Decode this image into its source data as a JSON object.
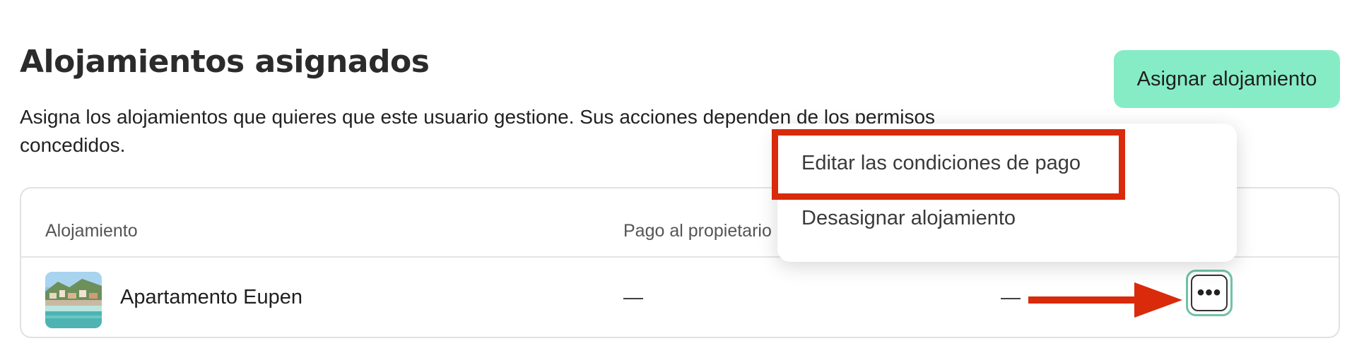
{
  "header": {
    "title": "Alojamientos asignados",
    "subtitle": "Asigna los alojamientos que quieres que este usuario gestione. Sus acciones dependen de los permisos concedidos.",
    "assign_button_label": "Asignar alojamiento"
  },
  "table": {
    "columns": [
      "Alojamiento",
      "Pago al propietario"
    ],
    "rows": [
      {
        "name": "Apartamento Eupen",
        "thumbnail_icon": "property-photo",
        "payment": "—",
        "other": "—",
        "actions_icon": "more-options-icon",
        "actions_label": "•••"
      }
    ]
  },
  "menu": {
    "items": [
      "Editar las condiciones de pago",
      "Desasignar alojamiento"
    ]
  },
  "annotation": {
    "highlight_color": "#d92a0b",
    "arrow_color": "#d92a0b"
  },
  "colors": {
    "primary_button": "#86ecc5",
    "focus_ring": "#6fc3a4"
  }
}
